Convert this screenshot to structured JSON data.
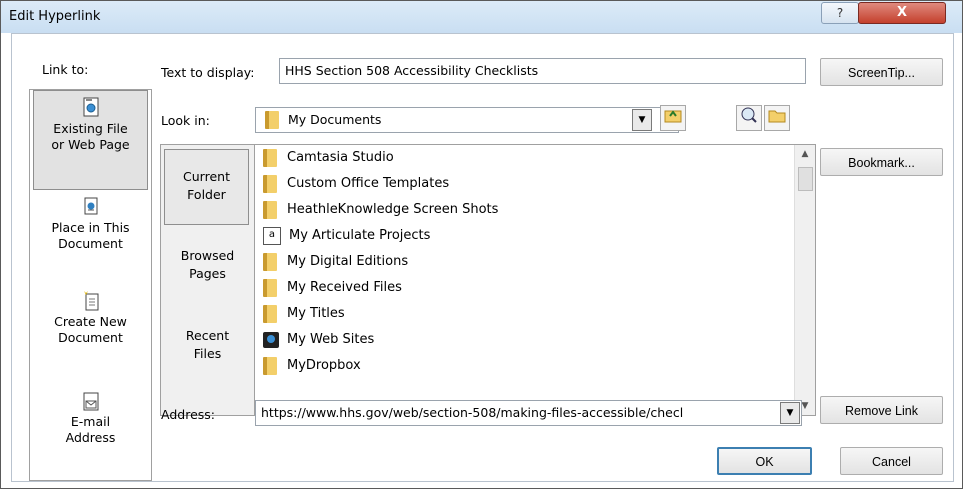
{
  "window": {
    "title": "Edit Hyperlink",
    "help_glyph": "?",
    "close_glyph": "X"
  },
  "link_to": {
    "heading": "Link to:",
    "items": [
      {
        "pre": "",
        "ul": "",
        "line1": "Existing File",
        "line2": "or Web Page",
        "icon": "web-page-icon"
      },
      {
        "line1": "Place in This",
        "line2": "Document",
        "icon": "place-in-document-icon"
      },
      {
        "line1": "Create New",
        "line2": "Document",
        "icon": "create-document-icon"
      },
      {
        "line1": "E-mail",
        "line2": "Address",
        "icon": "email-address-icon"
      }
    ]
  },
  "text_to_display": {
    "label": "Text to display:",
    "value": "HHS Section 508 Accessibility Checklists"
  },
  "look_in": {
    "label": "Look in:",
    "value": "My Documents"
  },
  "folder_tabs": [
    {
      "line1": "Current",
      "line2": "Folder"
    },
    {
      "line1": "Browsed",
      "line2": "Pages"
    },
    {
      "line1": "Recent",
      "line2": "Files"
    }
  ],
  "files": [
    {
      "name": "Camtasia Studio",
      "icon": "folder-icon"
    },
    {
      "name": "Custom Office Templates",
      "icon": "folder-icon"
    },
    {
      "name": "HeathleKnowledge Screen Shots",
      "icon": "folder-icon"
    },
    {
      "name": "My Articulate Projects",
      "icon": "project-folder-icon"
    },
    {
      "name": "My Digital Editions",
      "icon": "folder-icon"
    },
    {
      "name": "My Received Files",
      "icon": "folder-icon"
    },
    {
      "name": "My Titles",
      "icon": "folder-icon"
    },
    {
      "name": "My Web Sites",
      "icon": "web-sites-icon"
    },
    {
      "name": "MyDropbox",
      "icon": "folder-icon"
    }
  ],
  "address": {
    "label": "Address:",
    "value": "https://www.hhs.gov/web/section-508/making-files-accessible/checl"
  },
  "buttons": {
    "screentip": "ScreenTip...",
    "bookmark": "Bookmark...",
    "remove_link": "Remove Link",
    "ok": "OK",
    "cancel": "Cancel"
  },
  "colors": {
    "title_bar": "#c9def2",
    "close_button": "#c4402d",
    "ok_border": "#3c7fb1"
  }
}
